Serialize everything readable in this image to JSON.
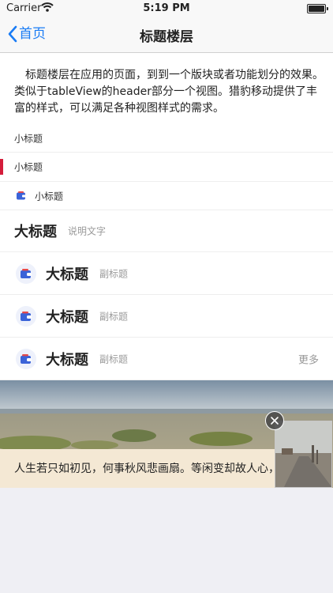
{
  "status": {
    "carrier": "Carrier",
    "time": "5:19 PM"
  },
  "nav": {
    "back_label": "首页",
    "title": "标题楼层"
  },
  "description": "标题楼层在应用的页面，到到一个版块或者功能划分的效果。类似于tableView的header部分一个视图。猎豹移动提供了丰富的样式，可以满足各种视图样式的需求。",
  "rows": [
    {
      "title": "小标题"
    },
    {
      "title": "小标题"
    },
    {
      "title": "小标题"
    },
    {
      "title": "大标题",
      "note": "说明文字"
    },
    {
      "title": "大标题",
      "subtitle": "副标题"
    },
    {
      "title": "大标题",
      "subtitle": "副标题"
    },
    {
      "title": "大标题",
      "subtitle": "副标题",
      "more": "更多"
    }
  ],
  "banner": {
    "caption": "人生若只如初见，何事秋风悲画扇。等闲变却故人心，"
  },
  "colors": {
    "accent": "#1a7cf5",
    "red_bar": "#d41d3b",
    "icon_blue": "#3b63d8"
  }
}
